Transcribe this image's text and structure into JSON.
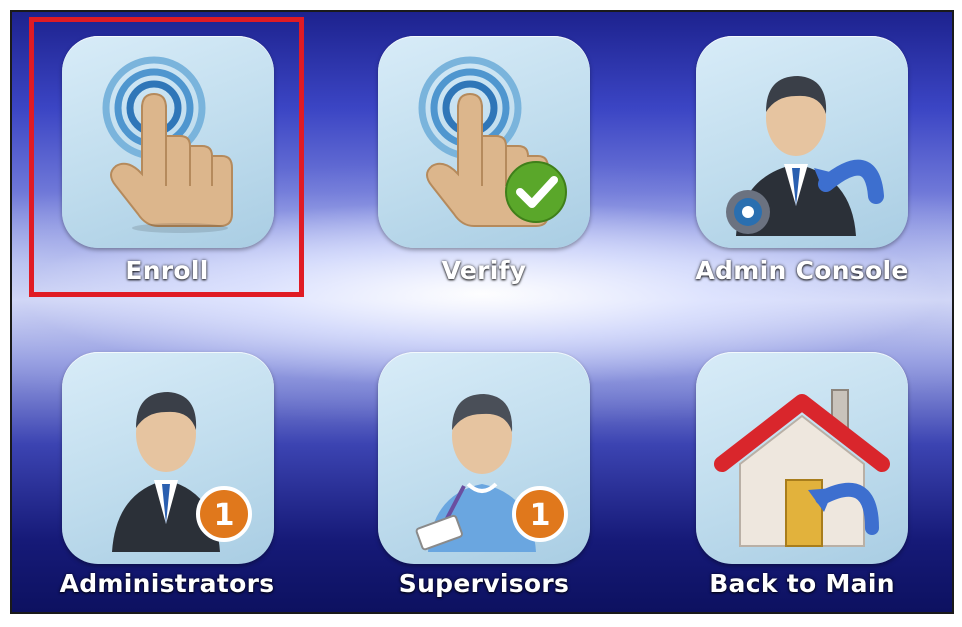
{
  "tiles": {
    "enroll": {
      "label": "Enroll",
      "icon": "fingerprint-touch-icon"
    },
    "verify": {
      "label": "Verify",
      "icon": "fingerprint-verify-icon"
    },
    "admin_console": {
      "label": "Admin Console",
      "icon": "admin-console-icon"
    },
    "administrators": {
      "label": "Administrators",
      "icon": "administrator-icon",
      "badge": "1"
    },
    "supervisors": {
      "label": "Supervisors",
      "icon": "supervisor-icon",
      "badge": "1"
    },
    "back_to_main": {
      "label": "Back to Main",
      "icon": "home-back-icon"
    }
  },
  "colors": {
    "highlight": "#e01b24",
    "tile": "#c9e2f1",
    "check": "#5aa72a",
    "badge": "#e0781c"
  }
}
